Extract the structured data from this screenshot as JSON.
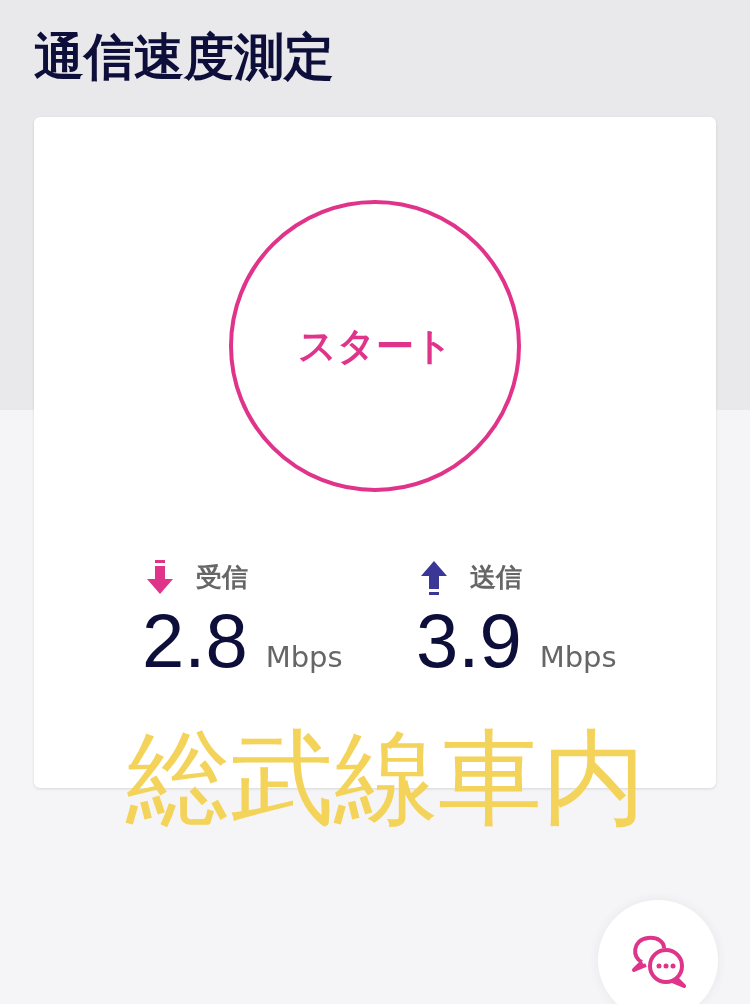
{
  "page_title": "通信速度測定",
  "start_button": {
    "label": "スタート"
  },
  "metrics": [
    {
      "kind": "download",
      "label": "受信",
      "value": "2.8",
      "unit": "Mbps"
    },
    {
      "kind": "upload",
      "label": "送信",
      "value": "3.9",
      "unit": "Mbps"
    }
  ],
  "caption_overlay": "総武線車内",
  "chat_button": {
    "kind": "chat"
  }
}
